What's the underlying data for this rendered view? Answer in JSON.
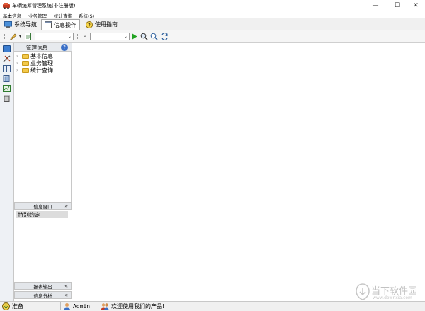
{
  "window": {
    "title": "车辆统筹管理系统(非注册版)",
    "minimize_glyph": "—",
    "maximize_glyph": "☐",
    "close_glyph": "✕"
  },
  "menu": [
    "基本信息",
    "业务管理",
    "统计查询",
    "系统(S)"
  ],
  "tabs": [
    {
      "label": "系统导航",
      "icon": "monitor-icon",
      "active": false
    },
    {
      "label": "信息操作",
      "icon": "window-icon",
      "active": true
    },
    {
      "label": "使用指南",
      "icon": "question-icon",
      "active": false
    }
  ],
  "nav_panel": {
    "title": "管理信息",
    "help_glyph": "?",
    "tree": [
      {
        "label": "基本信息"
      },
      {
        "label": "业务管理"
      },
      {
        "label": "统计查询"
      }
    ]
  },
  "info_window": {
    "title": "信息窗口",
    "items": [
      "特别约定"
    ]
  },
  "report_output": {
    "title": "报表输出"
  },
  "info_analysis": {
    "title": "信息分析"
  },
  "statusbar": {
    "status": "准备",
    "user": "Admin",
    "welcome": "欢迎使用我们的产品!"
  },
  "watermark": {
    "main": "当下软件园",
    "sub": "www.downxia.com"
  },
  "colors": {
    "accent_green": "#22a422",
    "folder": "#f3c94a",
    "selection": "#dcdcdc"
  }
}
